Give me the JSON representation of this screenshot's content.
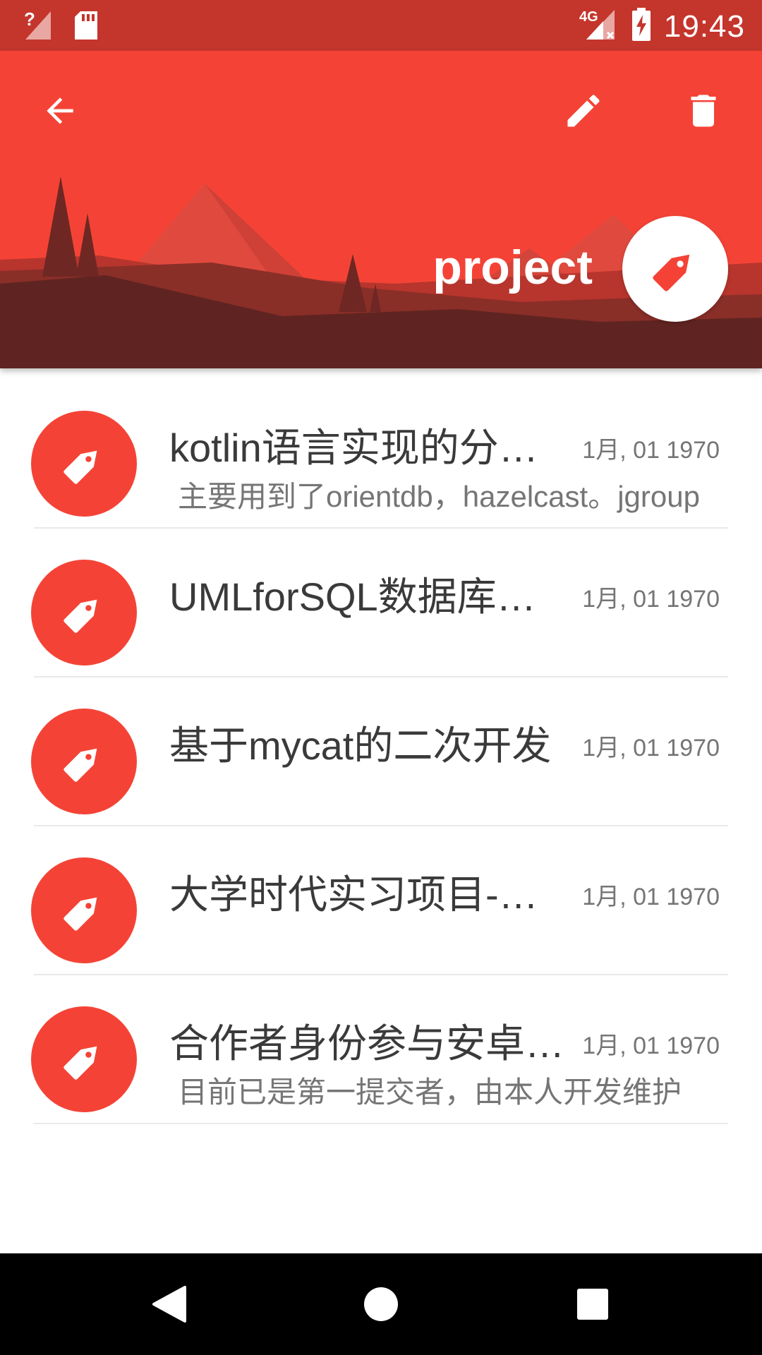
{
  "status_bar": {
    "time": "19:43",
    "network": "4G",
    "icons": [
      "wifi-unknown-icon",
      "sd-card-icon",
      "signal-no-data-icon",
      "battery-charging-icon"
    ]
  },
  "header": {
    "title": "project",
    "back_icon": "arrow-back-icon",
    "edit_icon": "pencil-icon",
    "delete_icon": "trash-icon",
    "badge_icon": "tag-icon",
    "color": "#f44336"
  },
  "items": [
    {
      "title": "kotlin语言实现的分布式数据库",
      "date": "1月, 01 1970",
      "subtitle": "主要用到了orientdb，hazelcast。jgroup"
    },
    {
      "title": "UMLforSQL数据库设计工具",
      "date": "1月, 01 1970",
      "subtitle": ""
    },
    {
      "title": "基于mycat的二次开发",
      "date": "1月, 01 1970",
      "subtitle": ""
    },
    {
      "title": "大学时代实习项目-图书管理",
      "date": "1月, 01 1970",
      "subtitle": ""
    },
    {
      "title": "合作者身份参与安卓开源项目",
      "date": "1月, 01 1970",
      "subtitle": "目前已是第一提交者，由本人开发维护"
    }
  ],
  "nav_bar": {
    "icons": [
      "back-triangle-icon",
      "home-circle-icon",
      "recents-square-icon"
    ]
  }
}
